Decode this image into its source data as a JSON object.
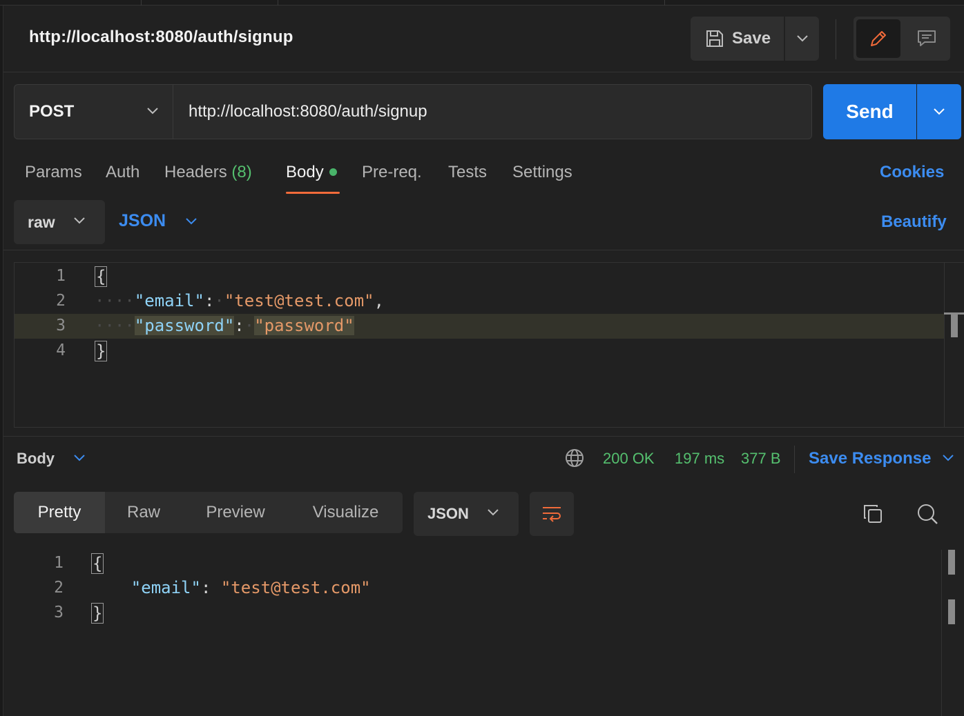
{
  "header": {
    "title": "http://localhost:8080/auth/signup",
    "save_label": "Save"
  },
  "request": {
    "method": "POST",
    "url": "http://localhost:8080/auth/signup",
    "send_label": "Send"
  },
  "tabs": [
    {
      "label": "Params"
    },
    {
      "label": "Auth"
    },
    {
      "label": "Headers",
      "count": "(8)"
    },
    {
      "label": "Body",
      "active": true
    },
    {
      "label": "Pre-req."
    },
    {
      "label": "Tests"
    },
    {
      "label": "Settings"
    }
  ],
  "cookies_label": "Cookies",
  "body_options": {
    "mode": "raw",
    "language": "JSON",
    "beautify_label": "Beautify"
  },
  "request_body": {
    "line_numbers": [
      "1",
      "2",
      "3",
      "4"
    ],
    "lines": [
      {
        "open": "{"
      },
      {
        "key": "\"email\"",
        "value": "\"test@test.com\""
      },
      {
        "key": "\"password\"",
        "value": "\"password\""
      },
      {
        "close": "}"
      }
    ]
  },
  "response": {
    "body_label": "Body",
    "status": "200 OK",
    "time": "197 ms",
    "size": "377 B",
    "save_response_label": "Save Response",
    "views": [
      "Pretty",
      "Raw",
      "Preview",
      "Visualize"
    ],
    "active_view": "Pretty",
    "format": "JSON",
    "line_numbers": [
      "1",
      "2",
      "3"
    ],
    "key": "\"email\"",
    "value": "\"test@test.com\""
  },
  "colors": {
    "accent_blue": "#1f7ae6",
    "link_blue": "#3c8cf0",
    "status_green": "#55c06f",
    "tab_active_underline": "#f26b3a",
    "json_key": "#8fd3f7",
    "json_string": "#e59968"
  },
  "icons": {
    "save": "save-icon",
    "edit": "pencil-icon",
    "comment": "comment-icon",
    "globe": "globe-icon",
    "wrap": "wrap-lines-icon",
    "copy": "copy-icon",
    "search": "search-icon"
  }
}
